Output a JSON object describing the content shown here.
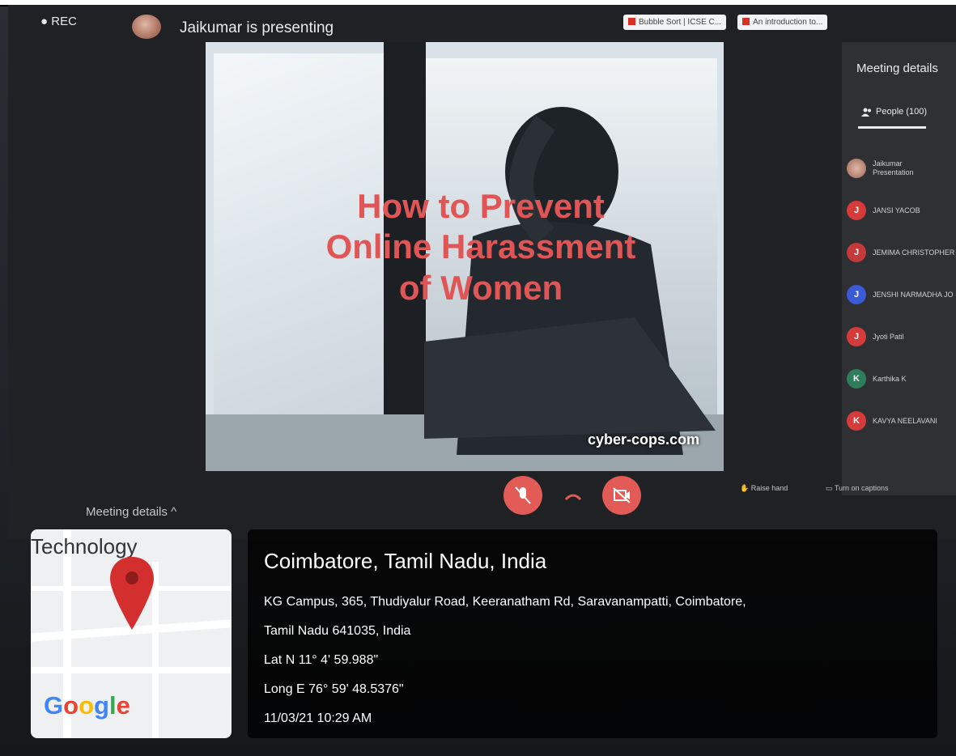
{
  "meet": {
    "rec_label": "REC",
    "presenting_text": "Jaikumar is presenting",
    "browser_tabs": [
      {
        "label": "Bubble Sort | ICSE C..."
      },
      {
        "label": "An introduction to..."
      }
    ],
    "slide": {
      "title_line1": "How to Prevent",
      "title_line2": "Online Harassment",
      "title_line3": "of Women",
      "watermark": "cyber-cops.com"
    },
    "panel": {
      "title": "Meeting details",
      "people_tab": "People (100)",
      "participants": [
        {
          "initial": "",
          "name": "Jaikumar",
          "sub": "Presentation",
          "color": "#b98a7a"
        },
        {
          "initial": "J",
          "name": "JANSI YACOB",
          "sub": "",
          "color": "#d63b3b"
        },
        {
          "initial": "J",
          "name": "JEMIMA CHRISTOPHER",
          "sub": "",
          "color": "#c43a3a"
        },
        {
          "initial": "J",
          "name": "JENSHI NARMADHA JO",
          "sub": "",
          "color": "#3b5bd6"
        },
        {
          "initial": "J",
          "name": "Jyoti Patil",
          "sub": "",
          "color": "#d63b3b"
        },
        {
          "initial": "K",
          "name": "Karthika K",
          "sub": "",
          "color": "#2e7d5b"
        },
        {
          "initial": "K",
          "name": "KAVYA NEELAVANI",
          "sub": "",
          "color": "#d63b3b"
        }
      ]
    },
    "controls": {
      "raise_hand": "Raise hand",
      "captions": "Turn on captions",
      "present": "Jaikumar is presenting",
      "meeting_details": "Meeting details"
    }
  },
  "location": {
    "map_label": "Technology",
    "map_brand": "Google",
    "city": "Coimbatore, Tamil Nadu, India",
    "address_line1": "KG Campus, 365, Thudiyalur Road, Keeranatham Rd, Saravanampatti, Coimbatore,",
    "address_line2": "Tamil Nadu 641035, India",
    "lat": "Lat N 11° 4' 59.988\"",
    "long": "Long E 76° 59' 48.5376\"",
    "datetime": "11/03/21 10:29 AM"
  }
}
